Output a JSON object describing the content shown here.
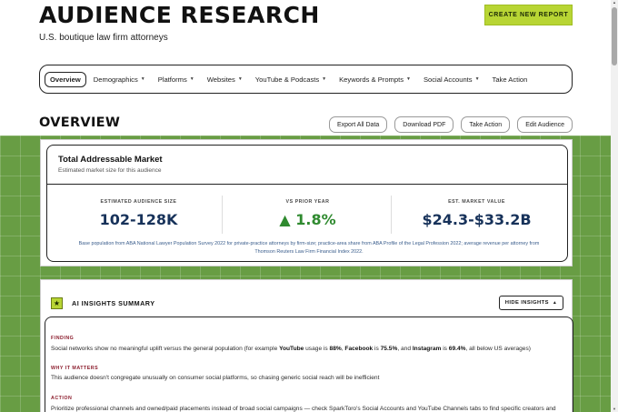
{
  "header": {
    "title": "AUDIENCE RESEARCH",
    "subtitle": "U.S. boutique law firm attorneys",
    "create_label": "CREATE NEW REPORT"
  },
  "nav": {
    "items": [
      {
        "label": "Overview",
        "dropdown": false,
        "active": true
      },
      {
        "label": "Demographics",
        "dropdown": true
      },
      {
        "label": "Platforms",
        "dropdown": true
      },
      {
        "label": "Websites",
        "dropdown": true
      },
      {
        "label": "YouTube & Podcasts",
        "dropdown": true
      },
      {
        "label": "Keywords & Prompts",
        "dropdown": true
      },
      {
        "label": "Social Accounts",
        "dropdown": true
      },
      {
        "label": "Take Action",
        "dropdown": false
      }
    ]
  },
  "section": {
    "title": "OVERVIEW",
    "actions": [
      "Export All Data",
      "Download PDF",
      "Take Action",
      "Edit Audience"
    ]
  },
  "tam": {
    "title": "Total Addressable Market",
    "subtitle": "Estimated market size for this audience",
    "metrics": [
      {
        "label": "ESTIMATED AUDIENCE SIZE",
        "value": "102-128K"
      },
      {
        "label": "VS PRIOR YEAR",
        "value": "▲ 1.8%"
      },
      {
        "label": "EST. MARKET VALUE",
        "value": "$24.3-$33.2B"
      }
    ],
    "note_line1": "Base population from ABA National Lawyer Population Survey 2022 for private-practice attorneys by firm-size; practice-area share from ABA Profile of the Legal Profession 2022; average revenue per attorney from",
    "note_line2": "Thomson Reuters Law Firm Financial Index 2022."
  },
  "insights": {
    "title": "AI INSIGHTS SUMMARY",
    "hide_label": "HIDE INSIGHTS",
    "finding_label": "FINDING",
    "finding_1": "Social networks show no meaningful uplift versus the general population (for example ",
    "finding_youtube": "YouTube",
    "finding_2": " usage is ",
    "finding_88": "88%",
    "finding_3": ", ",
    "finding_facebook": "Facebook",
    "finding_4": " is ",
    "finding_755": "75.5%",
    "finding_5": ", and ",
    "finding_instagram": "Instagram",
    "finding_6": " is ",
    "finding_694": "69.4%",
    "finding_7": ", all below US averages)",
    "why_label": "WHY IT MATTERS",
    "why_text": "This audience doesn't congregate unusually on consumer social platforms, so chasing generic social reach will be inefficient",
    "action_label": "ACTION",
    "action_text": "Prioritize professional channels and owned/paid placements instead of broad social campaigns — check SparkToro's Social Accounts and YouTube Channels tabs to find specific creators and"
  },
  "colors": {
    "accent": "#b8d534",
    "grid_bg": "#689d44",
    "metric_value": "#17325a",
    "positive": "#2f8a2f",
    "label_red": "#8b1c2c"
  }
}
